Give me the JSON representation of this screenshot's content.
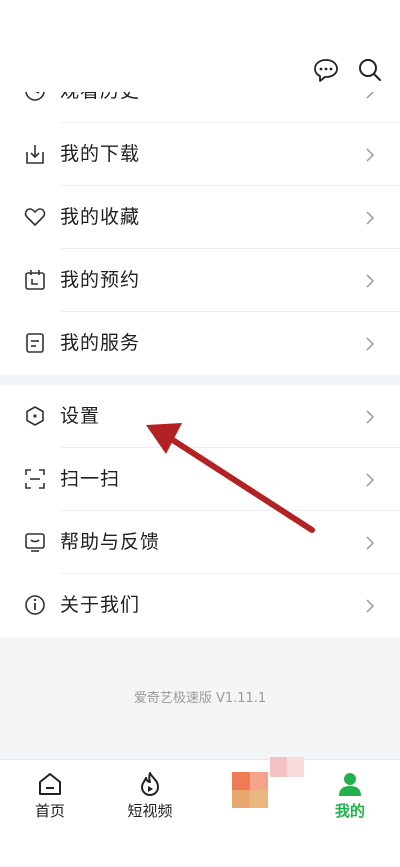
{
  "menu": {
    "items": [
      {
        "id": "history",
        "label": "观看历史",
        "icon": "history-icon"
      },
      {
        "id": "downloads",
        "label": "我的下载",
        "icon": "download-icon"
      },
      {
        "id": "favorites",
        "label": "我的收藏",
        "icon": "heart-icon"
      },
      {
        "id": "reservations",
        "label": "我的预约",
        "icon": "calendar-icon"
      },
      {
        "id": "services",
        "label": "我的服务",
        "icon": "services-icon"
      }
    ],
    "items2": [
      {
        "id": "settings",
        "label": "设置",
        "icon": "hexagon-settings-icon"
      },
      {
        "id": "scan",
        "label": "扫一扫",
        "icon": "scan-icon"
      },
      {
        "id": "help",
        "label": "帮助与反馈",
        "icon": "feedback-icon"
      },
      {
        "id": "about",
        "label": "关于我们",
        "icon": "info-icon"
      }
    ]
  },
  "footer": {
    "version_text": "爱奇艺极速版 V1.11.1"
  },
  "tabbar": {
    "home": "首页",
    "short_video": "短视频",
    "mine": "我的"
  },
  "colors": {
    "accent": "#22b14c",
    "arrow": "#b22222"
  }
}
